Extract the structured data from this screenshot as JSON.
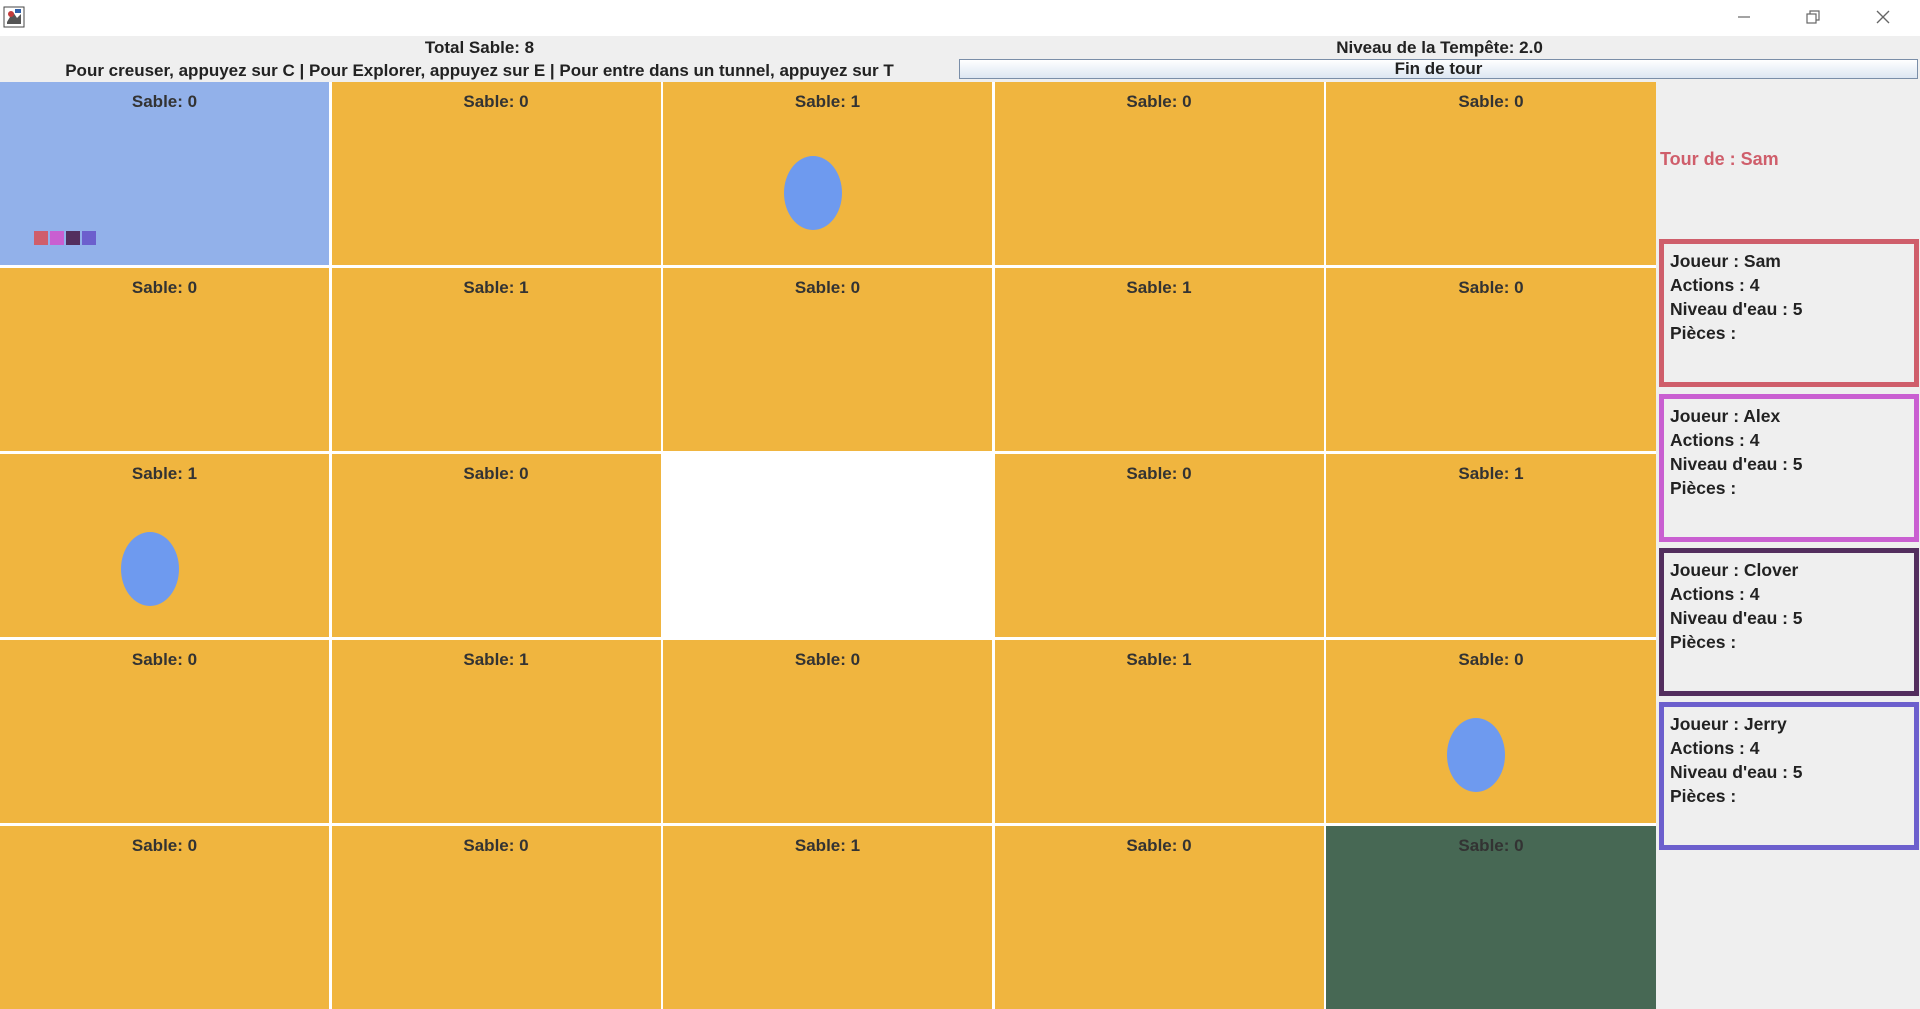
{
  "window": {
    "controls": {
      "minimize": "minimize-icon",
      "maximize": "restore-icon",
      "close": "close-icon"
    }
  },
  "header": {
    "total_sand": "Total Sable: 8",
    "storm_level": "Niveau de la Tempête: 2.0",
    "instructions": "Pour creuser, appuyez sur C | Pour Explorer, appuyez sur E | Pour entre dans un tunnel, appuyez sur T",
    "end_turn_label": "Fin de tour"
  },
  "colors": {
    "sand": "#f0b53f",
    "current_tile": "#92b1ea",
    "eye": "#ffffff",
    "dark_tile": "#476854",
    "water": "#6e9aef"
  },
  "board": {
    "rows": 5,
    "cols": 5,
    "cells": [
      {
        "label": "Sable: 0",
        "type": "current",
        "water": false,
        "players": [
          "#cf5e6b",
          "#c95fd1",
          "#532e5e",
          "#6c5fcd"
        ]
      },
      {
        "label": "Sable: 0",
        "type": "sand",
        "water": false
      },
      {
        "label": "Sable: 1",
        "type": "sand",
        "water": true
      },
      {
        "label": "Sable: 0",
        "type": "sand",
        "water": false
      },
      {
        "label": "Sable: 0",
        "type": "sand",
        "water": false
      },
      {
        "label": "Sable: 0",
        "type": "sand",
        "water": false
      },
      {
        "label": "Sable: 1",
        "type": "sand",
        "water": false
      },
      {
        "label": "Sable: 0",
        "type": "sand",
        "water": false
      },
      {
        "label": "Sable: 1",
        "type": "sand",
        "water": false
      },
      {
        "label": "Sable: 0",
        "type": "sand",
        "water": false
      },
      {
        "label": "Sable: 1",
        "type": "sand",
        "water": true
      },
      {
        "label": "Sable: 0",
        "type": "sand",
        "water": false
      },
      {
        "label": "",
        "type": "eye",
        "water": false
      },
      {
        "label": "Sable: 0",
        "type": "sand",
        "water": false
      },
      {
        "label": "Sable: 1",
        "type": "sand",
        "water": false
      },
      {
        "label": "Sable: 0",
        "type": "sand",
        "water": false
      },
      {
        "label": "Sable: 1",
        "type": "sand",
        "water": false
      },
      {
        "label": "Sable: 0",
        "type": "sand",
        "water": false
      },
      {
        "label": "Sable: 1",
        "type": "sand",
        "water": false
      },
      {
        "label": "Sable: 0",
        "type": "sand",
        "water": true
      },
      {
        "label": "Sable: 0",
        "type": "sand",
        "water": false
      },
      {
        "label": "Sable: 0",
        "type": "sand",
        "water": false
      },
      {
        "label": "Sable: 1",
        "type": "sand",
        "water": false
      },
      {
        "label": "Sable: 0",
        "type": "sand",
        "water": false
      },
      {
        "label": "Sable: 0",
        "type": "dark",
        "water": false
      }
    ]
  },
  "sidebar": {
    "turn": {
      "label": "Tour de : Sam",
      "color": "#cf5e6b"
    },
    "players": [
      {
        "name": "Joueur : Sam",
        "actions": "Actions : 4",
        "water": "Niveau d'eau : 5",
        "pieces": "Pièces :",
        "color": "#cf5e6b"
      },
      {
        "name": "Joueur : Alex",
        "actions": "Actions : 4",
        "water": "Niveau d'eau : 5",
        "pieces": "Pièces :",
        "color": "#c95fd1"
      },
      {
        "name": "Joueur : Clover",
        "actions": "Actions : 4",
        "water": "Niveau d'eau : 5",
        "pieces": "Pièces :",
        "color": "#532e5e"
      },
      {
        "name": "Joueur : Jerry",
        "actions": "Actions : 4",
        "water": "Niveau d'eau : 5",
        "pieces": "Pièces :",
        "color": "#6c5fcd"
      }
    ]
  }
}
